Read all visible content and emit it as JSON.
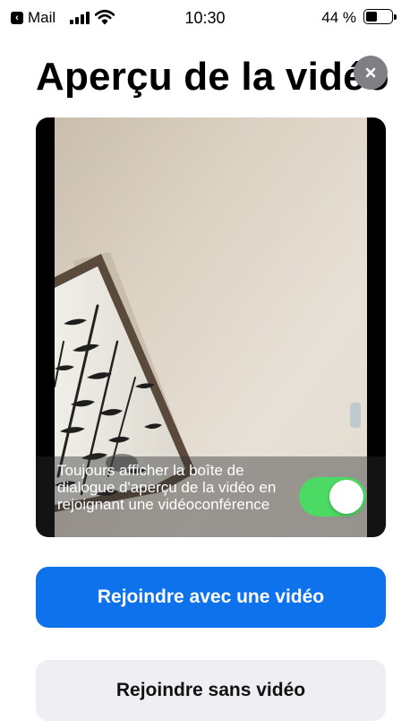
{
  "status_bar": {
    "back_app": "Mail",
    "time": "10:30",
    "battery_percent": "44 %",
    "battery_level": 0.44,
    "back_icon": "chevron-left-icon",
    "signal_icon": "cellular-signal-icon",
    "wifi_icon": "wifi-icon",
    "battery_icon": "battery-icon"
  },
  "header": {
    "title": "Aperçu de la vidéo",
    "close_icon": "close-icon"
  },
  "preview": {
    "always_show_label": "Toujours afficher la boîte de dialogue d'aperçu de la vidéo en rejoignant une vidéoconférence",
    "toggle_on": true
  },
  "actions": {
    "join_with_video": "Rejoindre avec une vidéo",
    "join_without_video": "Rejoindre sans vidéo"
  },
  "colors": {
    "primary": "#0e72ed",
    "toggle_on": "#4cd964",
    "close_bg": "#7f7f84",
    "secondary_bg": "#eeeef3"
  }
}
